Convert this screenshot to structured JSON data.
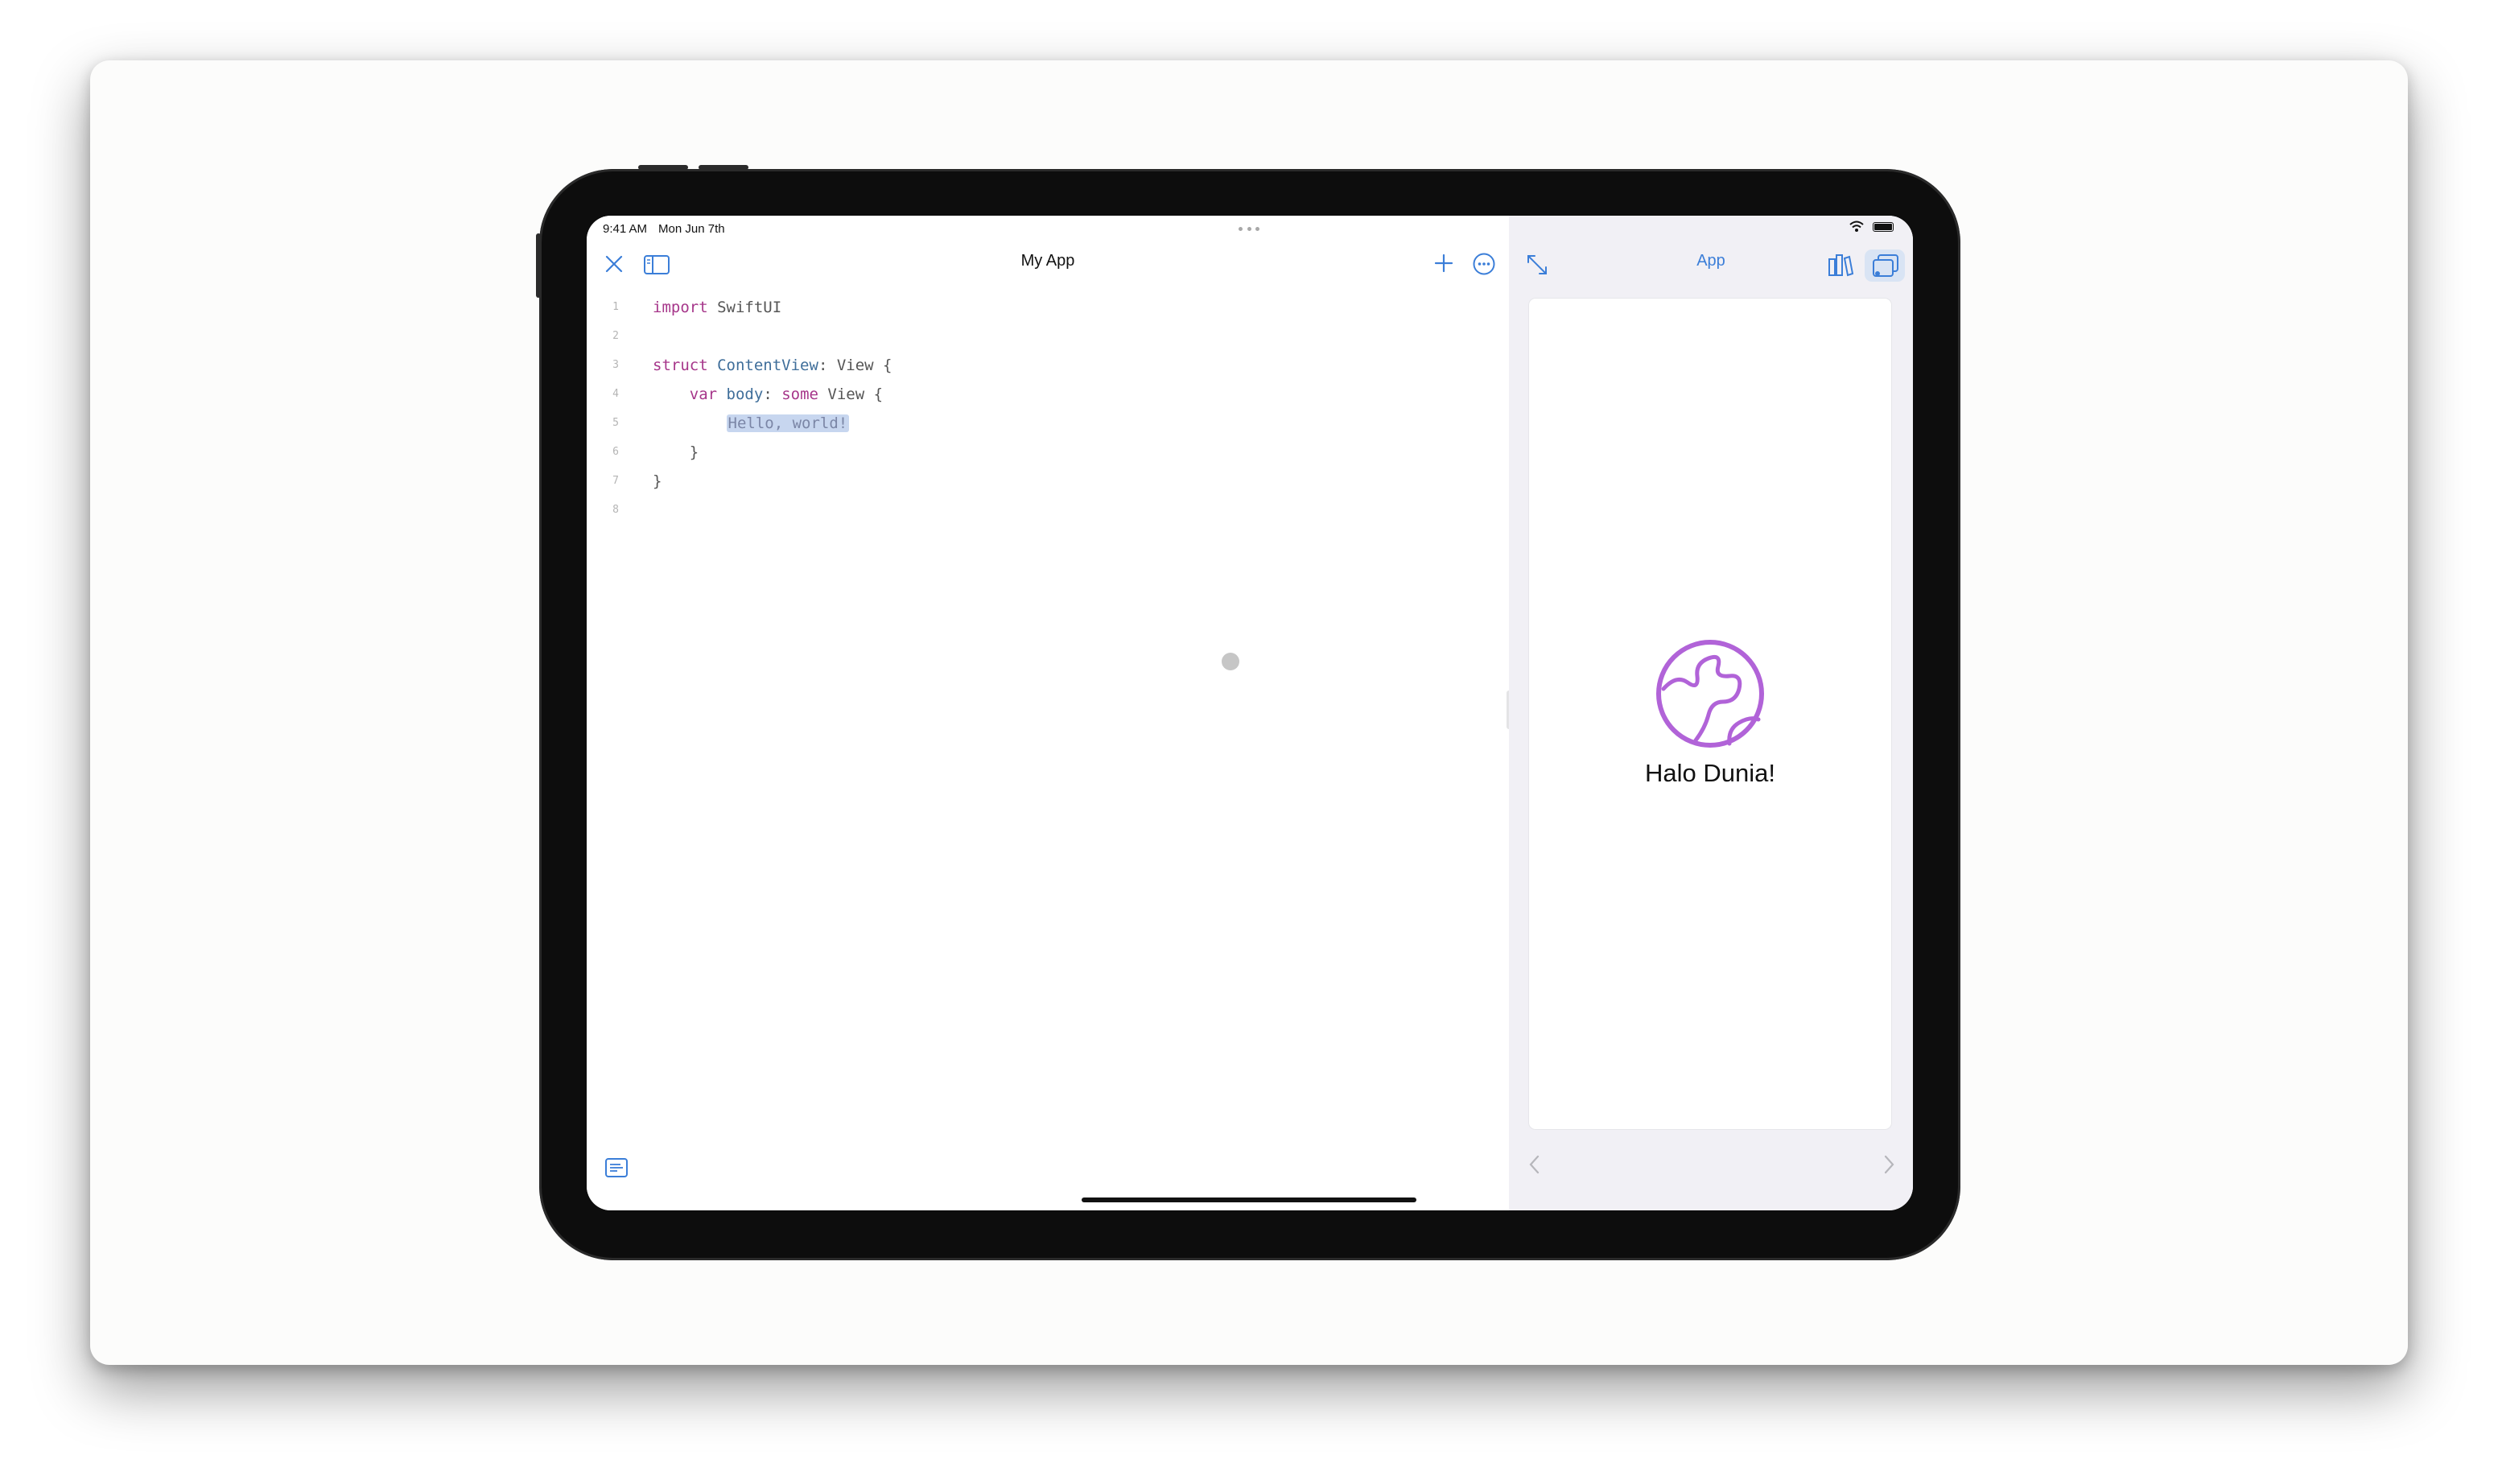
{
  "status_bar": {
    "time": "9:41 AM",
    "date": "Mon Jun 7th"
  },
  "editor": {
    "title": "My App",
    "code_lines": [
      {
        "n": "1",
        "tokens": [
          {
            "t": "import",
            "c": "kw"
          },
          {
            "t": " SwiftUI",
            "c": "pl"
          }
        ]
      },
      {
        "n": "2",
        "tokens": []
      },
      {
        "n": "3",
        "tokens": [
          {
            "t": "struct",
            "c": "kw"
          },
          {
            "t": " ",
            "c": "pl"
          },
          {
            "t": "ContentView",
            "c": "ty"
          },
          {
            "t": ": View {",
            "c": "pl"
          }
        ]
      },
      {
        "n": "4",
        "tokens": [
          {
            "t": "    ",
            "c": "pl"
          },
          {
            "t": "var",
            "c": "kw"
          },
          {
            "t": " ",
            "c": "pl"
          },
          {
            "t": "body",
            "c": "ty"
          },
          {
            "t": ": ",
            "c": "pl"
          },
          {
            "t": "some",
            "c": "kw"
          },
          {
            "t": " View {",
            "c": "pl"
          }
        ]
      },
      {
        "n": "5",
        "tokens": [
          {
            "t": "        ",
            "c": "pl"
          },
          {
            "t": "Hello, world!",
            "c": "sel"
          }
        ]
      },
      {
        "n": "6",
        "tokens": [
          {
            "t": "    }",
            "c": "pl"
          }
        ]
      },
      {
        "n": "7",
        "tokens": [
          {
            "t": "}",
            "c": "pl"
          }
        ]
      },
      {
        "n": "8",
        "tokens": []
      }
    ]
  },
  "preview": {
    "title": "App",
    "greeting": "Halo Dunia!"
  },
  "icons": {
    "close": "close-icon",
    "sidebar": "sidebar-icon",
    "add": "plus-icon",
    "more": "ellipsis-circle-icon",
    "expand": "expand-arrows-icon",
    "library": "library-icon",
    "preview_mode": "app-preview-icon",
    "globe": "globe-icon",
    "console": "console-icon",
    "back": "chevron-left-icon",
    "forward": "chevron-right-icon",
    "wifi": "wifi-icon",
    "battery": "battery-icon"
  },
  "colors": {
    "accent": "#3b7ed8",
    "keyword": "#a6368a",
    "type": "#3f6e9a",
    "globe": "#b163d8",
    "selection": "#c7d6ef"
  }
}
